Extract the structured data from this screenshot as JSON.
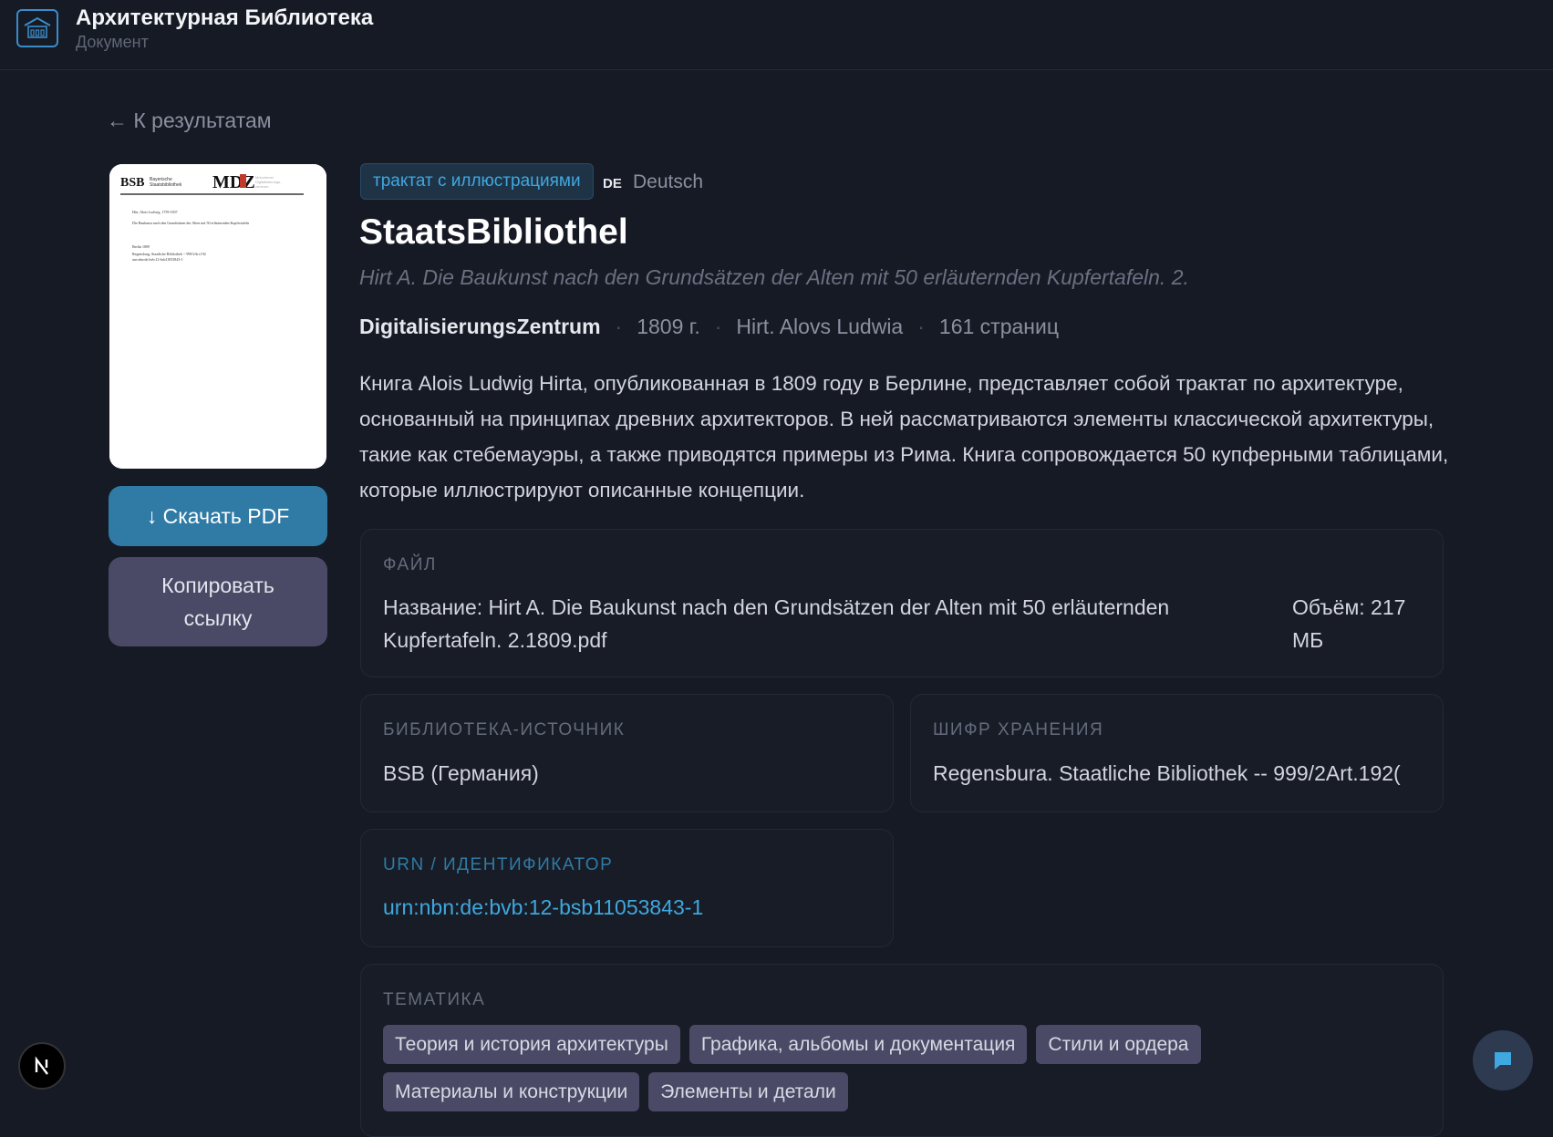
{
  "header": {
    "app_title": "Архитектурная Библиотека",
    "app_subtitle": "Документ"
  },
  "nav": {
    "back_label": "← К результатам"
  },
  "cover": {
    "lines": [
      "Hirt, Alois Ludwig, 1759-1837",
      "Die Baukunst nach den Grundsätzen der Alten mit 50 erläuternden Kupfertafeln",
      "Berlin 1809",
      "Regensburg, Staatliche Bibliothek -- 999/2Art.192",
      "urn:nbn:de:bvb:12-bsb11053843-1"
    ]
  },
  "actions": {
    "download_label": "↓ Скачать PDF",
    "copy_label": "Копировать ссылку"
  },
  "document": {
    "type_badge": "трактат с иллюстрациями",
    "lang_code": "DE",
    "lang_name": "Deutsch",
    "title": "StaatsBibliothel",
    "subtitle": "Hirt A. Die Baukunst nach den Grundsätzen der Alten mit 50 erläuternden Kupfertafeln. 2.",
    "publisher": "DigitalisierungsZentrum",
    "year": "1809 г.",
    "author": "Hirt. Alovs Ludwia",
    "pages": "161 страниц",
    "description": "Книга Alois Ludwig Hirta, опубликованная в 1809 году в Берлине, представляет собой трактат по архитектуре, основанный на принципах древних архитекторов. В ней рассматриваются элементы классической архитектуры, такие как стебемауэры, а также приводятся примеры из Рима. Книга сопровождается 50 купферными таблицами, которые иллюстрируют описанные концепции."
  },
  "file": {
    "label": "ФАЙЛ",
    "name": "Название: Hirt A. Die Baukunst nach den Grundsätzen der Alten mit 50 erläuternden Kupfertafeln. 2.1809.pdf",
    "size": "Объём: 217 МБ"
  },
  "library": {
    "label": "БИБЛИОТЕКА-ИСТОЧНИК",
    "value": "BSB (Германия)"
  },
  "shelfmark": {
    "label": "ШИФР ХРАНЕНИЯ",
    "value": "Regensbura. Staatliche Bibliothek -- 999/2Art.192("
  },
  "urn": {
    "label": "URN / ИДЕНТИФИКАТОР",
    "value": "urn:nbn:de:bvb:12-bsb11053843-1"
  },
  "topics": {
    "label": "ТЕМАТИКА",
    "tags": [
      "Теория и история архитектуры",
      "Графика, альбомы и документация",
      "Стили и ордера",
      "Материалы и конструкции",
      "Элементы и детали"
    ]
  },
  "icons": {
    "logo": "library-building-icon",
    "framework_badge": "next-js-icon",
    "chat": "chat-bubble-icon"
  },
  "colors": {
    "accent": "#3fa8e0",
    "download_button": "#2f7ba5",
    "secondary_button": "#4a4a66",
    "background": "#161a24"
  }
}
